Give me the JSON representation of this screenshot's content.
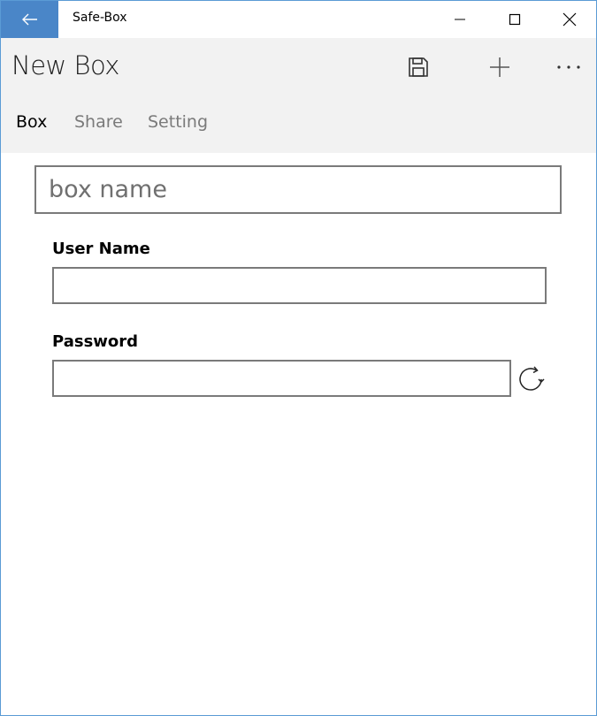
{
  "window": {
    "title": "Safe-Box",
    "accent_color": "#4a86c8",
    "border_color": "#5b9bd5"
  },
  "titlebar": {
    "back_icon": "arrow-left-icon",
    "minimize_icon": "minimize-icon",
    "maximize_icon": "maximize-icon",
    "close_icon": "close-icon"
  },
  "header": {
    "title": "New Box",
    "commands": [
      {
        "name": "save",
        "icon": "save-icon"
      },
      {
        "name": "add",
        "icon": "plus-icon"
      },
      {
        "name": "more",
        "icon": "more-icon"
      }
    ],
    "tabs": [
      {
        "label": "Box",
        "active": true
      },
      {
        "label": "Share",
        "active": false
      },
      {
        "label": "Setting",
        "active": false
      }
    ]
  },
  "form": {
    "box_name": {
      "value": "",
      "placeholder": "box name"
    },
    "user_name": {
      "label": "User Name",
      "value": ""
    },
    "password": {
      "label": "Password",
      "value": "",
      "action_icon": "refresh-icon"
    }
  }
}
